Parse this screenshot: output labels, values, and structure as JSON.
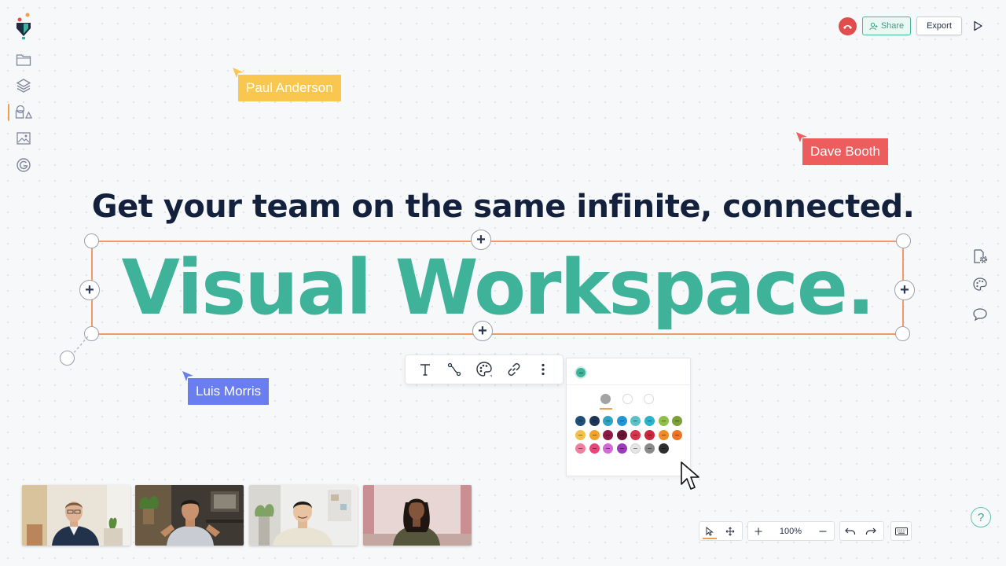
{
  "header": {
    "share_label": "Share",
    "export_label": "Export"
  },
  "collaborators": [
    {
      "name": "Paul Anderson",
      "color": "#f9c74f"
    },
    {
      "name": "Dave Booth",
      "color": "#ee5d5d"
    },
    {
      "name": "Luis Morris",
      "color": "#6a7ef0"
    }
  ],
  "canvas": {
    "subheading": "Get your team on the same infinite, connected.",
    "headline": "Visual Workspace.",
    "headline_color": "#3eb39a",
    "selection_color": "#ef9a6b"
  },
  "left_toolbar": {
    "items": [
      "folder-icon",
      "layers-icon",
      "shapes-icon",
      "image-icon",
      "integrations-icon"
    ],
    "active": "shapes-icon"
  },
  "text_toolbar": {
    "items": [
      "text-icon",
      "connector-icon",
      "color-palette-icon",
      "link-icon",
      "more-options-icon"
    ]
  },
  "palette": {
    "current_color": "#3eb39a",
    "styles": [
      "solid",
      "outline",
      "none"
    ],
    "swatches": [
      [
        "#1f4e79",
        "#1d3557",
        "#2fa3c4",
        "#2196d3",
        "#5bc0c8",
        "#2ab3c9",
        "#8fbe4a",
        "#7ba03a"
      ],
      [
        "#f3c14b",
        "#f0a32c",
        "#8e1b46",
        "#6b1237",
        "#d7344a",
        "#c9283b",
        "#f08a24",
        "#ee7423"
      ],
      [
        "#ef7f9e",
        "#e8457a",
        "#d26ad6",
        "#9b3ab8",
        "#e6e6e6",
        "#8a8a8a",
        "#2e2e2e"
      ]
    ]
  },
  "right_toolbar": {
    "items": [
      "page-settings-icon",
      "theme-palette-icon",
      "comment-icon"
    ]
  },
  "video_participants": 4,
  "bottom_bar": {
    "zoom": "100%"
  },
  "help_label": "?"
}
